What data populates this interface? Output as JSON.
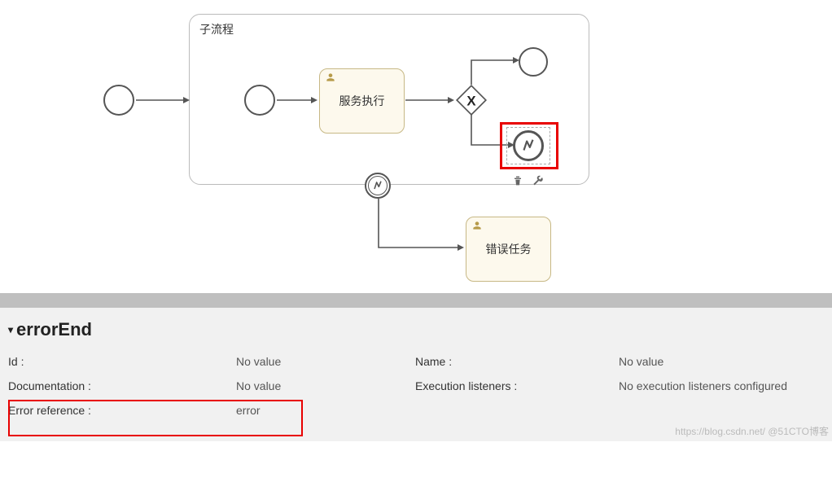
{
  "diagram": {
    "subprocess_label": "子流程",
    "task_service_label": "服务执行",
    "task_error_label": "错误任务",
    "gateway_marker": "X"
  },
  "properties": {
    "section_title": "errorEnd",
    "id_label": "Id :",
    "id_value": "No value",
    "name_label": "Name :",
    "name_value": "No value",
    "doc_label": "Documentation :",
    "doc_value": "No value",
    "exec_label": "Execution listeners :",
    "exec_value": "No execution listeners configured",
    "errref_label": "Error reference :",
    "errref_value": "error"
  },
  "watermark": "https://blog.csdn.net/ @51CTO博客"
}
